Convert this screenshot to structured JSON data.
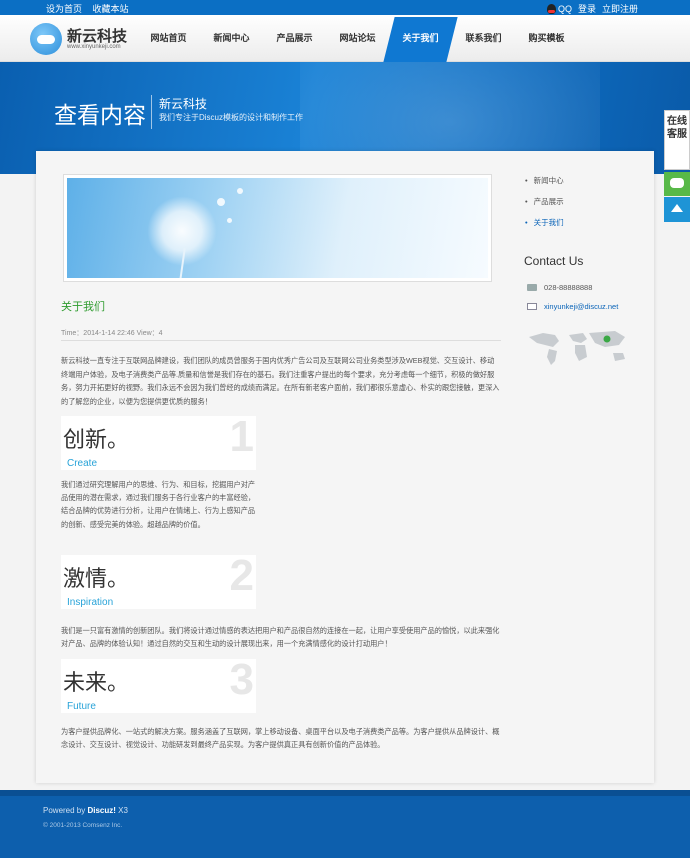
{
  "topbar": {
    "set_home": "设为首页",
    "bookmark": "收藏本站",
    "qq": "QQ",
    "login": "登录",
    "register": "立即注册"
  },
  "header": {
    "logo_title": "新云科技",
    "logo_url": "www.xinyunkeji.com",
    "nav": [
      "网站首页",
      "新闻中心",
      "产品展示",
      "网站论坛",
      "关于我们",
      "联系我们",
      "购买模板"
    ],
    "active_nav": "关于我们"
  },
  "banner": {
    "title": "查看内容",
    "site_name": "新云科技",
    "slogan": "我们专注于Discuz模板的设计和制作工作"
  },
  "article": {
    "title": "关于我们",
    "meta": "Time：2014-1-14 22:46   View：4",
    "intro": "新云科技一直专注于互联网品牌建设，我们团队的成员曾服务于国内优秀广告公司及互联网公司业务类型涉及WEB视觉、交互设计、移动终端用户体验，及电子消费类产品等.质量和信誉是我们存在的基石。我们注重客户提出的每个要求，充分考虑每一个细节，积极的做好服务，努力开拓更好的视野。我们永远不会因为我们曾经的成绩而满足。在所有新老客户面前，我们都很乐意虚心、朴实的跟您接触，更深入的了解您的企业，以便为您提供更优质的服务！",
    "sections": [
      {
        "num": "1",
        "cn": "创新。",
        "en": "Create",
        "text": "我们通过研究理解用户的思维、行为、和目标，挖掘用户对产品使用的潜在需求，通过我们服务于各行业客户的丰富经验，结合品牌的优势进行分析，让用户在情绪上、行为上感知产品的创新、感受完美的体验。超越品牌的价值。"
      },
      {
        "num": "2",
        "cn": "激情。",
        "en": "Inspiration",
        "text": "我们是一只富有激情的创新团队。我们将设计通过情感的表达把用户和产品很自然的连接在一起，让用户享受使用产品的愉悦，以此来强化对产品、品牌的体验认知！通过自然的交互和生动的设计展现出来，用一个充满情感化的设计打动用户！"
      },
      {
        "num": "3",
        "cn": "未来。",
        "en": "Future",
        "text": "为客户提供品牌化、一站式的解决方案。服务涵盖了互联网，掌上移动设备、桌面平台以及电子消费类产品等。为客户提供从品牌设计、概念设计、交互设计、视觉设计、功能研发到最终产品实现。为客户提供真正具有创新价值的产品体验。"
      }
    ]
  },
  "sidebar": {
    "links": [
      "新闻中心",
      "产品展示",
      "关于我们"
    ],
    "active_link": "关于我们",
    "contact_title": "Contact Us",
    "phone": "028-88888888",
    "email": "xinyunkeji@discuz.net"
  },
  "float": {
    "service_label": "在线客服"
  },
  "footer": {
    "powered_prefix": "Powered by ",
    "powered_brand": "Discuz!",
    "powered_version": " X3",
    "copyright": "© 2001-2013 Comsenz Inc."
  },
  "colors": {
    "brand_blue": "#0b6fc4",
    "title_green": "#2f9c2f",
    "link_blue": "#0a64b8",
    "accent_cyan": "#28a3d8"
  }
}
